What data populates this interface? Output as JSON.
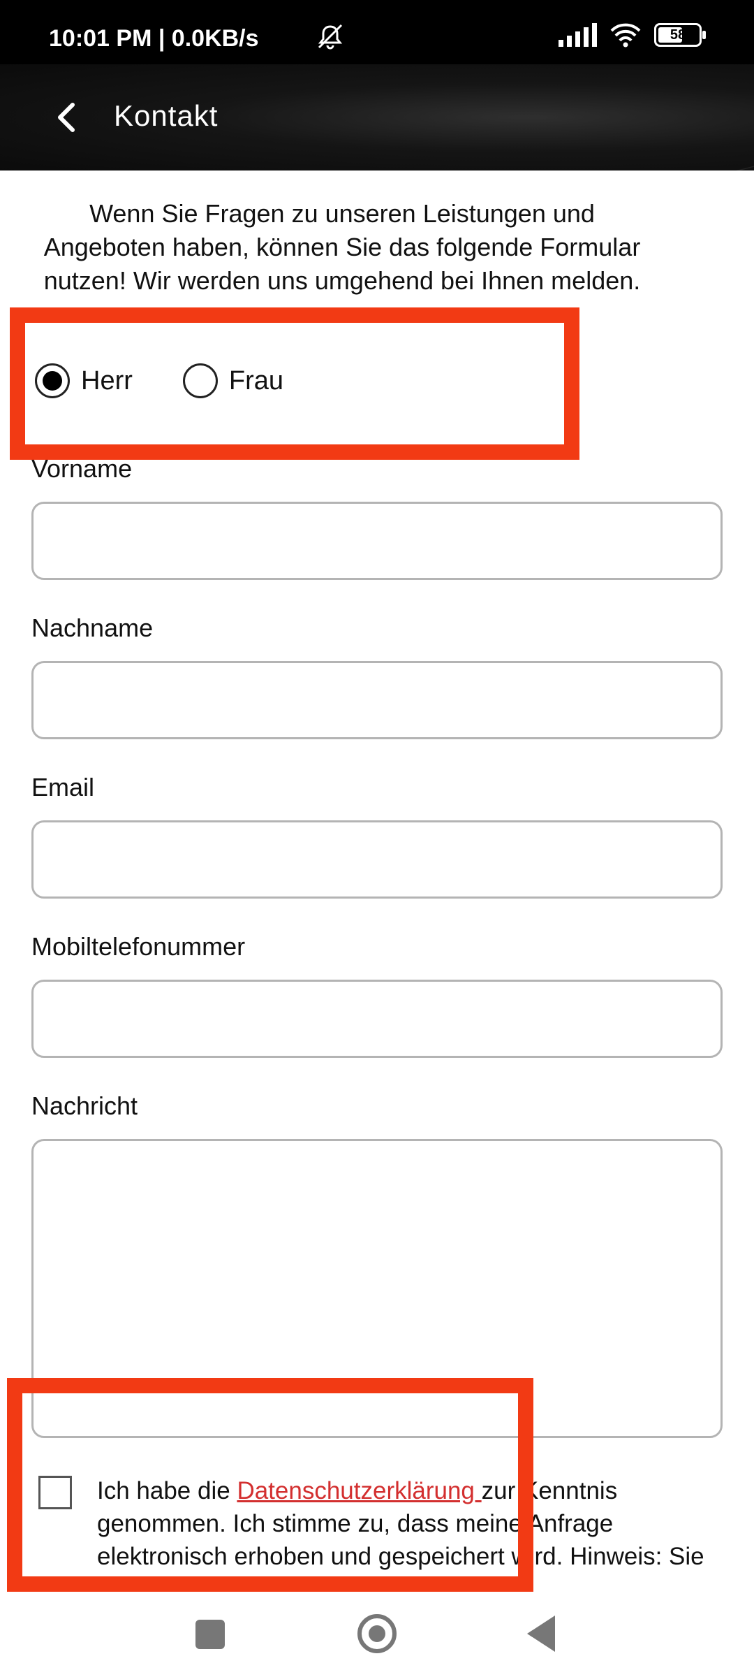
{
  "status_bar": {
    "time": "10:01 PM | 0.0KB/s",
    "battery": "58"
  },
  "header": {
    "title": "Kontakt"
  },
  "intro_text": "Wenn Sie Fragen zu unseren Leistungen und Angeboten haben, können Sie das folgende Formular  nutzen! Wir werden uns umgehend bei Ihnen melden.",
  "salutation": {
    "options": [
      {
        "label": "Herr",
        "selected": true
      },
      {
        "label": "Frau",
        "selected": false
      }
    ]
  },
  "form": {
    "first_name_label": "Vorname",
    "first_name_value": "",
    "last_name_label": "Nachname",
    "last_name_value": "",
    "email_label": "Email",
    "email_value": "",
    "phone_label": "Mobiltelefonummer",
    "phone_value": "",
    "message_label": "Nachricht",
    "message_value": ""
  },
  "consent": {
    "prefix": "Ich habe die ",
    "link": "Datenschutzerklärung ",
    "suffix": "zur Kenntnis genommen. Ich stimme zu, dass meine Anfrage elektronisch erhoben und gespeichert wird. Hinweis: Sie können Ihre Einwilligung jederzeit",
    "checked": false
  },
  "colors": {
    "annotation": "#f23a14",
    "link": "#d32f2f",
    "header_bg": "#151515"
  }
}
